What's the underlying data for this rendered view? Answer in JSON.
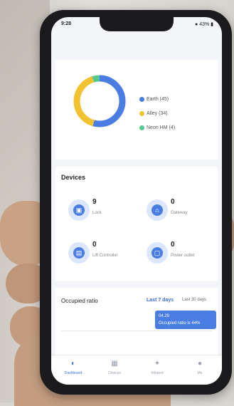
{
  "status": {
    "time": "9:28",
    "right": "● 43% ▮"
  },
  "donut_chart": {
    "segments": [
      {
        "label": "Earth (45)",
        "value": 45,
        "color": "#4a7de2"
      },
      {
        "label": "Alley (34)",
        "value": 34,
        "color": "#f2c230"
      },
      {
        "label": "Neon HM (4)",
        "value": 4,
        "color": "#56c991"
      }
    ]
  },
  "devices": {
    "title": "Devices",
    "items": [
      {
        "count": "9",
        "label": "Lock",
        "icon": "lock-icon",
        "glyph": "▣"
      },
      {
        "count": "0",
        "label": "Gateway",
        "icon": "gateway-icon",
        "glyph": "⌂"
      },
      {
        "count": "0",
        "label": "Lift Controller",
        "icon": "lift-controller-icon",
        "glyph": "▤"
      },
      {
        "count": "0",
        "label": "Power outlet",
        "icon": "power-outlet-icon",
        "glyph": "▢"
      }
    ]
  },
  "occupied": {
    "title": "Occupied ratio",
    "tab_active": "Last 7 days",
    "tab_other": "Last 30 days",
    "tooltip_date": "04.29",
    "tooltip_value": "Occupied ratio is 44%"
  },
  "tabbar": {
    "items": [
      {
        "label": "Dashboard",
        "glyph": "◐"
      },
      {
        "label": "Devices",
        "glyph": "▦"
      },
      {
        "label": "Infrared",
        "glyph": "✦"
      },
      {
        "label": "Me",
        "glyph": "●"
      }
    ]
  }
}
